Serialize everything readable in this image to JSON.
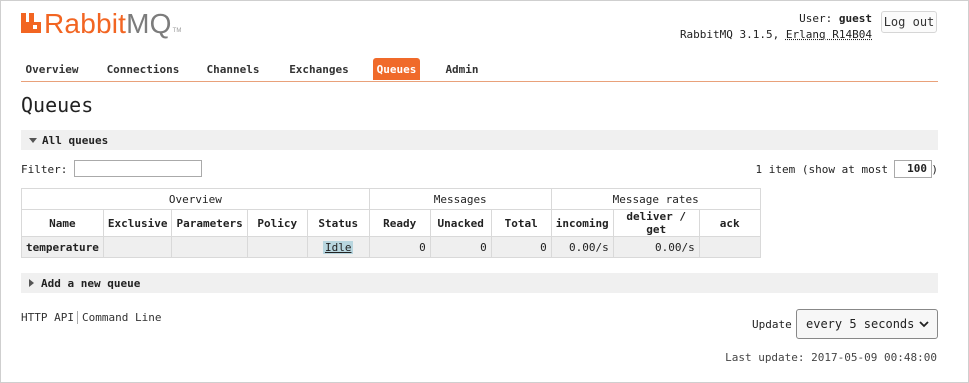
{
  "logo": {
    "rabbit": "Rabbit",
    "mq": "MQ",
    "tm": "TM"
  },
  "header": {
    "user_label": "User:",
    "user_name": "guest",
    "version": "RabbitMQ 3.1.5,",
    "erlang": "Erlang R14B04",
    "logout": "Log out"
  },
  "tabs": [
    "Overview",
    "Connections",
    "Channels",
    "Exchanges",
    "Queues",
    "Admin"
  ],
  "page_title": "Queues",
  "all_queues": {
    "label": "All queues"
  },
  "filter": {
    "label": "Filter:",
    "value": ""
  },
  "paging": {
    "info": "1 item (show at most",
    "max": "100",
    "close": ")"
  },
  "table": {
    "groups": [
      "Overview",
      "Messages",
      "Message rates"
    ],
    "columns": [
      "Name",
      "Exclusive",
      "Parameters",
      "Policy",
      "Status",
      "Ready",
      "Unacked",
      "Total",
      "incoming",
      "deliver / get",
      "ack"
    ],
    "rows": [
      {
        "name": "temperature",
        "exclusive": "",
        "parameters": "",
        "policy": "",
        "status": "Idle",
        "ready": "0",
        "unacked": "0",
        "total": "0",
        "incoming": "0.00/s",
        "deliver_get": "0.00/s",
        "ack": ""
      }
    ]
  },
  "add_queue": {
    "label": "Add a new queue"
  },
  "footer": {
    "http_api": "HTTP API",
    "command_line": "Command Line"
  },
  "update": {
    "label": "Update",
    "selected": "every 5 seconds"
  },
  "last_update": "Last update: 2017-05-09 00:48:00",
  "colors": {
    "accent": "#f06a2a",
    "idle_bg": "#b8d6df"
  }
}
